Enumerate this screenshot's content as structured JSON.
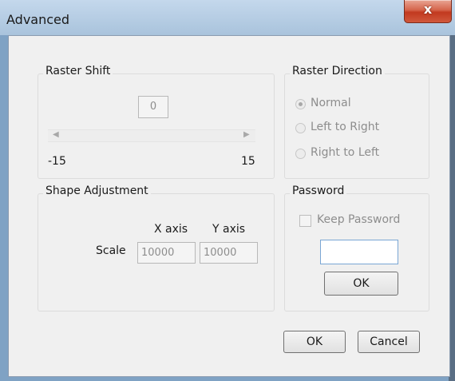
{
  "window": {
    "title": "Advanced",
    "close_glyph": "x"
  },
  "raster_shift": {
    "label": "Raster Shift",
    "value": "0",
    "slider_min_label": "-15",
    "slider_max_label": "15",
    "left_arrow": "◀",
    "right_arrow": "▶"
  },
  "raster_direction": {
    "label": "Raster Direction",
    "options": [
      {
        "label": "Normal",
        "selected": true
      },
      {
        "label": "Left to Right",
        "selected": false
      },
      {
        "label": "Right to Left",
        "selected": false
      }
    ]
  },
  "shape_adjustment": {
    "label": "Shape Adjustment",
    "x_axis_label": "X axis",
    "y_axis_label": "Y axis",
    "scale_label": "Scale",
    "x_value": "10000",
    "y_value": "10000"
  },
  "password": {
    "label": "Password",
    "keep_label": "Keep Password",
    "keep_checked": false,
    "value": "",
    "ok_label": "OK"
  },
  "footer": {
    "ok_label": "OK",
    "cancel_label": "Cancel"
  }
}
